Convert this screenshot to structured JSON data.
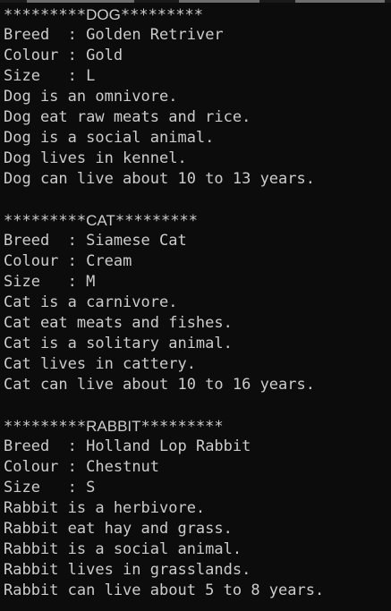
{
  "sections": [
    {
      "stars": "*********",
      "name": "DOG",
      "attrs": [
        {
          "key": "Breed  ",
          "value": "Golden Retriver"
        },
        {
          "key": "Colour ",
          "value": "Gold"
        },
        {
          "key": "Size   ",
          "value": "L"
        }
      ],
      "facts": [
        "Dog is an omnivore.",
        "Dog eat raw meats and rice.",
        "Dog is a social animal.",
        "Dog lives in kennel.",
        "Dog can live about 10 to 13 years."
      ]
    },
    {
      "stars": "*********",
      "name": "CAT",
      "attrs": [
        {
          "key": "Breed  ",
          "value": "Siamese Cat"
        },
        {
          "key": "Colour ",
          "value": "Cream"
        },
        {
          "key": "Size   ",
          "value": "M"
        }
      ],
      "facts": [
        "Cat is a carnivore.",
        "Cat eat meats and fishes.",
        "Cat is a solitary animal.",
        "Cat lives in cattery.",
        "Cat can live about 10 to 16 years."
      ]
    },
    {
      "stars": "*********",
      "name": "RABBIT",
      "attrs": [
        {
          "key": "Breed  ",
          "value": "Holland Lop Rabbit"
        },
        {
          "key": "Colour ",
          "value": "Chestnut"
        },
        {
          "key": "Size   ",
          "value": "S"
        }
      ],
      "facts": [
        "Rabbit is a herbivore.",
        "Rabbit eat hay and grass.",
        "Rabbit is a social animal.",
        "Rabbit lives in grasslands.",
        "Rabbit can live about 5 to 8 years."
      ]
    }
  ],
  "colors": {
    "background": "#0c0c0c",
    "text": "#cccccc"
  }
}
